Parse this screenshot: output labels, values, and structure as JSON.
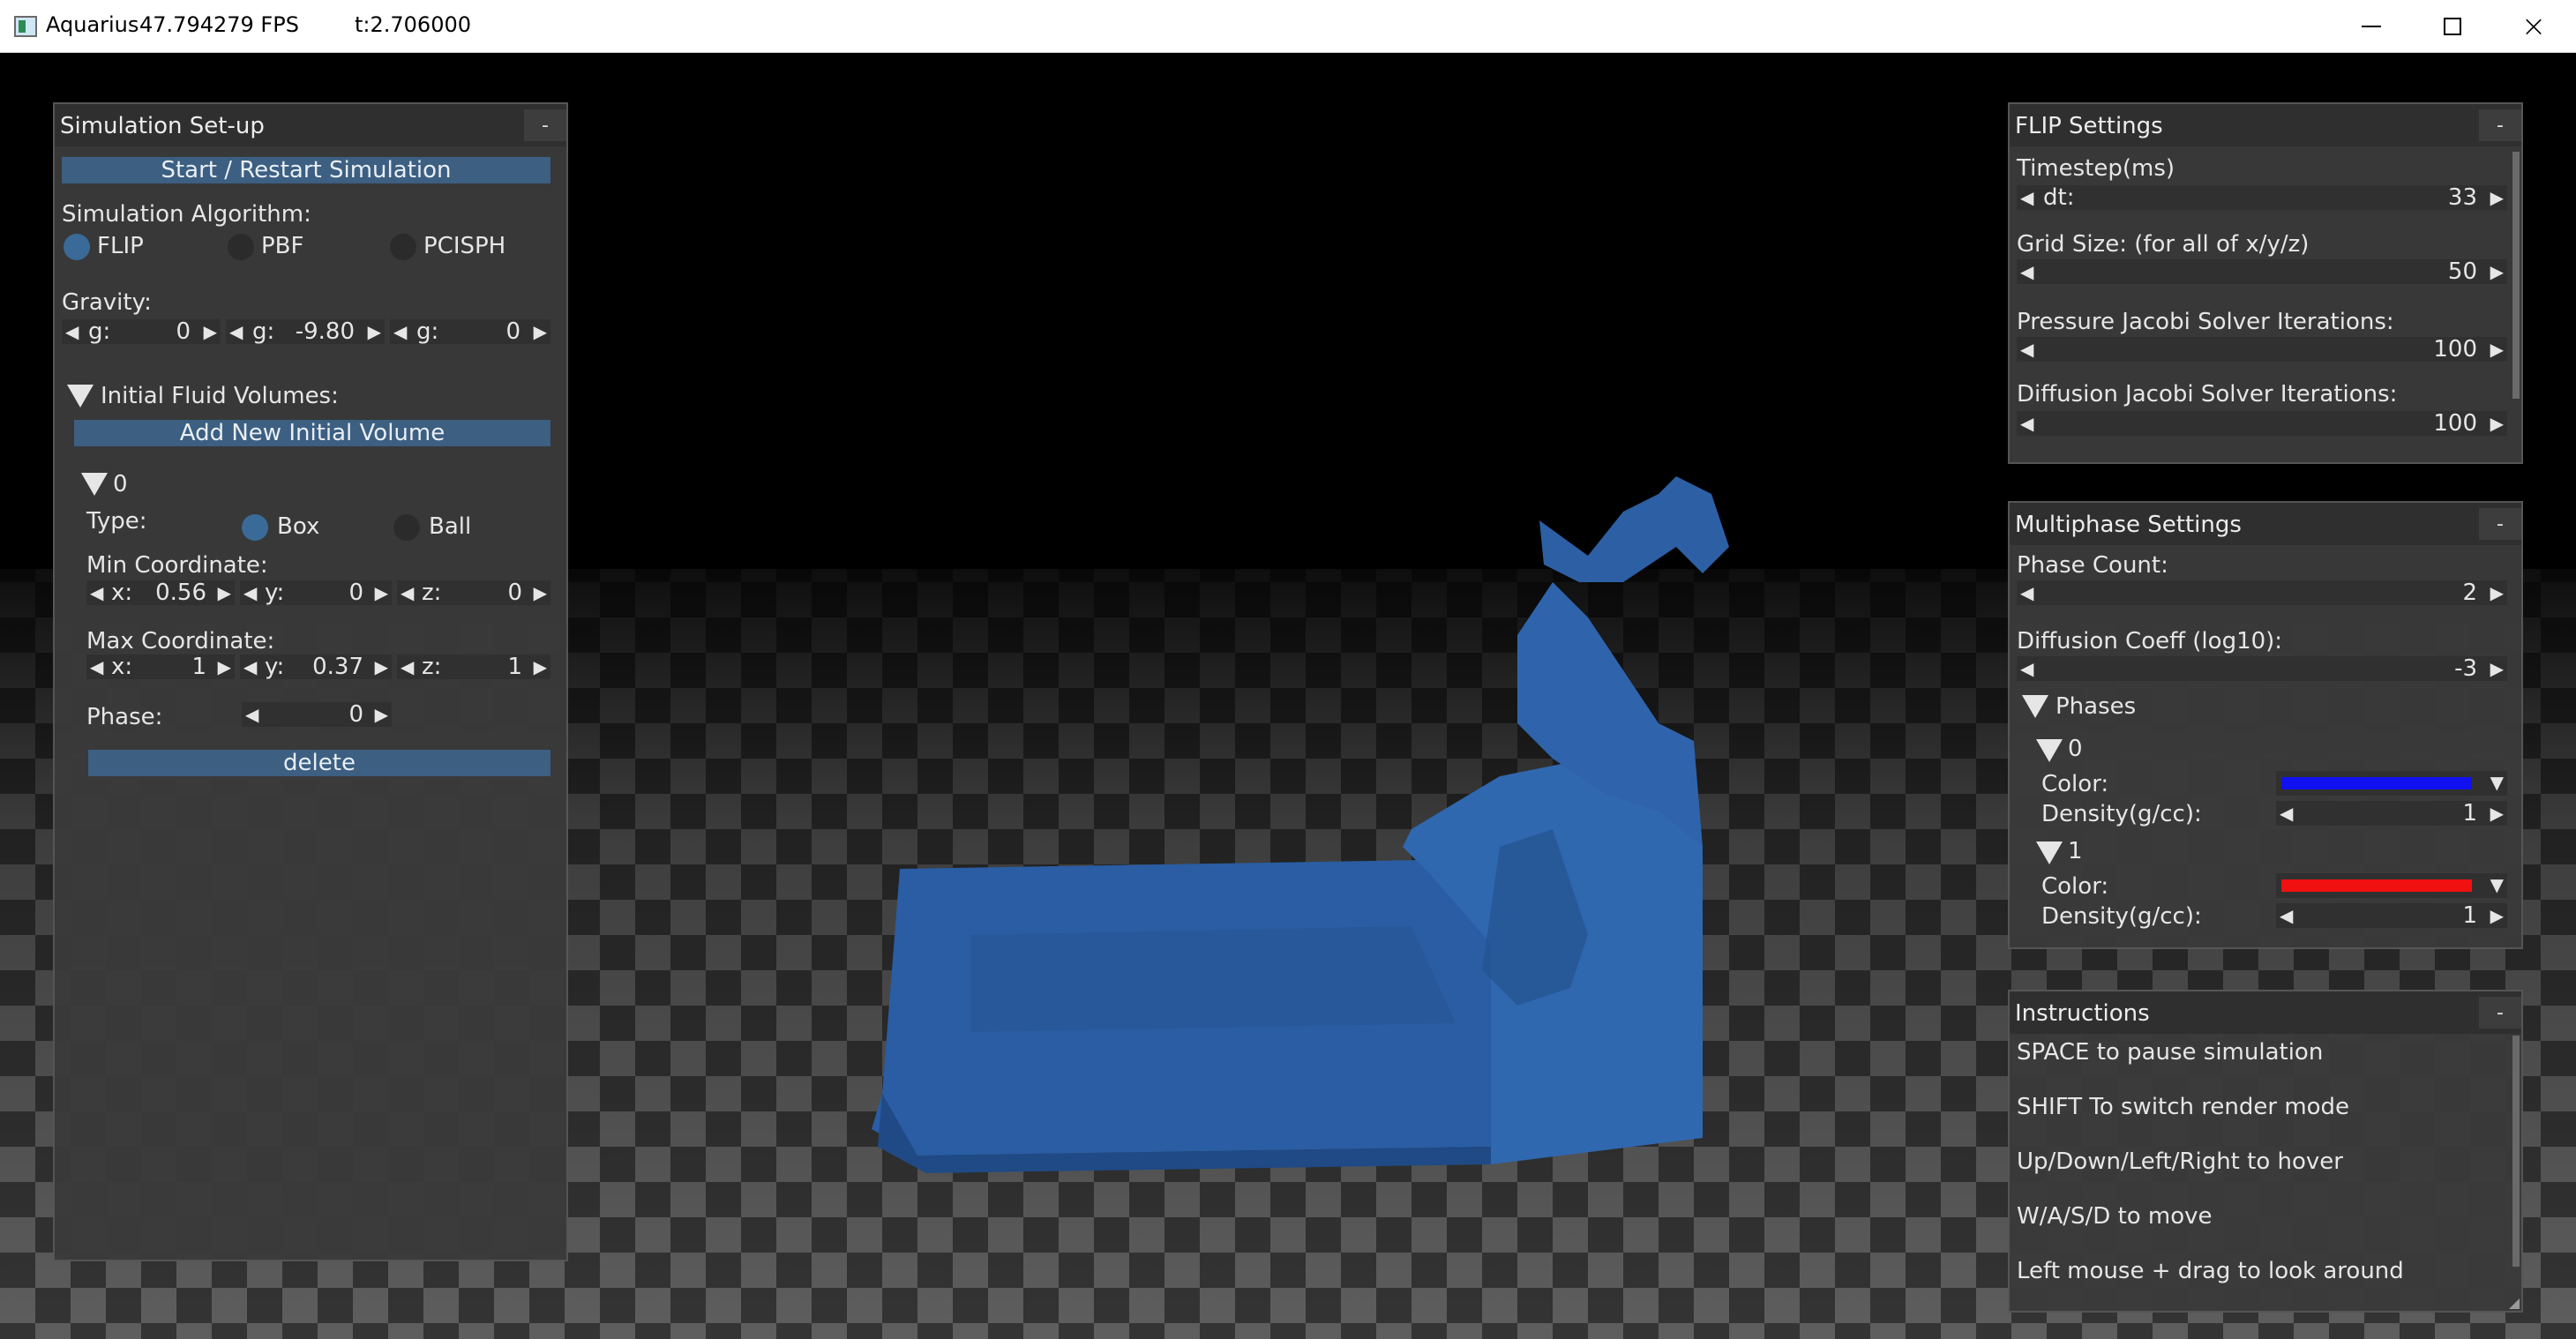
{
  "window": {
    "title": "Aquarius",
    "fps": "47.794279 FPS",
    "time": "t:2.706000",
    "controls": {
      "minimize": "minimize-icon",
      "maximize": "maximize-icon",
      "close": "×"
    }
  },
  "colors": {
    "fluid": "#2a5da3",
    "panel": "#3a3a3a",
    "button": "#3c5f82",
    "phase0": "#1010f0",
    "phase1": "#f01010"
  },
  "setup": {
    "title": "Simulation Set-up",
    "collapse": "-",
    "start_button": "Start / Restart Simulation",
    "algorithm_label": "Simulation Algorithm:",
    "algorithms": [
      "FLIP",
      "PBF",
      "PCISPH"
    ],
    "algorithm_selected": "FLIP",
    "gravity_label": "Gravity:",
    "gravity": [
      {
        "name": "g:",
        "value": "0"
      },
      {
        "name": "g:",
        "value": "-9.80"
      },
      {
        "name": "g:",
        "value": "0"
      }
    ],
    "volumes_header": "Initial Fluid Volumes:",
    "add_volume_button": "Add New Initial Volume",
    "volume": {
      "index": "0",
      "type_label": "Type:",
      "types": [
        "Box",
        "Ball"
      ],
      "type_selected": "Box",
      "min_label": "Min Coordinate:",
      "min": [
        {
          "name": "x:",
          "value": "0.56"
        },
        {
          "name": "y:",
          "value": "0"
        },
        {
          "name": "z:",
          "value": "0"
        }
      ],
      "max_label": "Max Coordinate:",
      "max": [
        {
          "name": "x:",
          "value": "1"
        },
        {
          "name": "y:",
          "value": "0.37"
        },
        {
          "name": "z:",
          "value": "1"
        }
      ],
      "phase_label": "Phase:",
      "phase_value": "0",
      "delete_button": "delete"
    }
  },
  "flip": {
    "title": "FLIP Settings",
    "collapse": "-",
    "timestep_label": "Timestep(ms)",
    "dt_name": "dt:",
    "dt_value": "33",
    "grid_label": "Grid Size: (for all of x/y/z)",
    "grid_value": "50",
    "pressure_label": "Pressure Jacobi Solver Iterations:",
    "pressure_value": "100",
    "diffusion_label": "Diffusion Jacobi Solver Iterations:",
    "diffusion_value": "100"
  },
  "multiphase": {
    "title": "Multiphase Settings",
    "collapse": "-",
    "phase_count_label": "Phase Count:",
    "phase_count_value": "2",
    "diffusion_label": "Diffusion Coeff (log10):",
    "diffusion_value": "-3",
    "phases_header": "Phases",
    "phases": [
      {
        "index": "0",
        "color_label": "Color:",
        "density_label": "Density(g/cc):",
        "density": "1"
      },
      {
        "index": "1",
        "color_label": "Color:",
        "density_label": "Density(g/cc):",
        "density": "1"
      }
    ]
  },
  "instructions": {
    "title": "Instructions",
    "collapse": "-",
    "items": [
      "SPACE to pause simulation",
      "SHIFT To switch render mode",
      "Up/Down/Left/Right to hover",
      "W/A/S/D to move",
      "Left mouse + drag to look around"
    ]
  }
}
